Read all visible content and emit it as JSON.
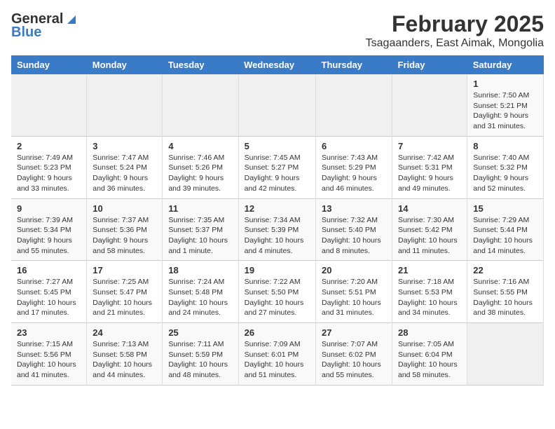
{
  "header": {
    "logo_general": "General",
    "logo_blue": "Blue",
    "title": "February 2025",
    "subtitle": "Tsagaanders, East Aimak, Mongolia"
  },
  "calendar": {
    "days_of_week": [
      "Sunday",
      "Monday",
      "Tuesday",
      "Wednesday",
      "Thursday",
      "Friday",
      "Saturday"
    ],
    "weeks": [
      [
        {
          "day": "",
          "detail": ""
        },
        {
          "day": "",
          "detail": ""
        },
        {
          "day": "",
          "detail": ""
        },
        {
          "day": "",
          "detail": ""
        },
        {
          "day": "",
          "detail": ""
        },
        {
          "day": "",
          "detail": ""
        },
        {
          "day": "1",
          "detail": "Sunrise: 7:50 AM\nSunset: 5:21 PM\nDaylight: 9 hours and 31 minutes."
        }
      ],
      [
        {
          "day": "2",
          "detail": "Sunrise: 7:49 AM\nSunset: 5:23 PM\nDaylight: 9 hours and 33 minutes."
        },
        {
          "day": "3",
          "detail": "Sunrise: 7:47 AM\nSunset: 5:24 PM\nDaylight: 9 hours and 36 minutes."
        },
        {
          "day": "4",
          "detail": "Sunrise: 7:46 AM\nSunset: 5:26 PM\nDaylight: 9 hours and 39 minutes."
        },
        {
          "day": "5",
          "detail": "Sunrise: 7:45 AM\nSunset: 5:27 PM\nDaylight: 9 hours and 42 minutes."
        },
        {
          "day": "6",
          "detail": "Sunrise: 7:43 AM\nSunset: 5:29 PM\nDaylight: 9 hours and 46 minutes."
        },
        {
          "day": "7",
          "detail": "Sunrise: 7:42 AM\nSunset: 5:31 PM\nDaylight: 9 hours and 49 minutes."
        },
        {
          "day": "8",
          "detail": "Sunrise: 7:40 AM\nSunset: 5:32 PM\nDaylight: 9 hours and 52 minutes."
        }
      ],
      [
        {
          "day": "9",
          "detail": "Sunrise: 7:39 AM\nSunset: 5:34 PM\nDaylight: 9 hours and 55 minutes."
        },
        {
          "day": "10",
          "detail": "Sunrise: 7:37 AM\nSunset: 5:36 PM\nDaylight: 9 hours and 58 minutes."
        },
        {
          "day": "11",
          "detail": "Sunrise: 7:35 AM\nSunset: 5:37 PM\nDaylight: 10 hours and 1 minute."
        },
        {
          "day": "12",
          "detail": "Sunrise: 7:34 AM\nSunset: 5:39 PM\nDaylight: 10 hours and 4 minutes."
        },
        {
          "day": "13",
          "detail": "Sunrise: 7:32 AM\nSunset: 5:40 PM\nDaylight: 10 hours and 8 minutes."
        },
        {
          "day": "14",
          "detail": "Sunrise: 7:30 AM\nSunset: 5:42 PM\nDaylight: 10 hours and 11 minutes."
        },
        {
          "day": "15",
          "detail": "Sunrise: 7:29 AM\nSunset: 5:44 PM\nDaylight: 10 hours and 14 minutes."
        }
      ],
      [
        {
          "day": "16",
          "detail": "Sunrise: 7:27 AM\nSunset: 5:45 PM\nDaylight: 10 hours and 17 minutes."
        },
        {
          "day": "17",
          "detail": "Sunrise: 7:25 AM\nSunset: 5:47 PM\nDaylight: 10 hours and 21 minutes."
        },
        {
          "day": "18",
          "detail": "Sunrise: 7:24 AM\nSunset: 5:48 PM\nDaylight: 10 hours and 24 minutes."
        },
        {
          "day": "19",
          "detail": "Sunrise: 7:22 AM\nSunset: 5:50 PM\nDaylight: 10 hours and 27 minutes."
        },
        {
          "day": "20",
          "detail": "Sunrise: 7:20 AM\nSunset: 5:51 PM\nDaylight: 10 hours and 31 minutes."
        },
        {
          "day": "21",
          "detail": "Sunrise: 7:18 AM\nSunset: 5:53 PM\nDaylight: 10 hours and 34 minutes."
        },
        {
          "day": "22",
          "detail": "Sunrise: 7:16 AM\nSunset: 5:55 PM\nDaylight: 10 hours and 38 minutes."
        }
      ],
      [
        {
          "day": "23",
          "detail": "Sunrise: 7:15 AM\nSunset: 5:56 PM\nDaylight: 10 hours and 41 minutes."
        },
        {
          "day": "24",
          "detail": "Sunrise: 7:13 AM\nSunset: 5:58 PM\nDaylight: 10 hours and 44 minutes."
        },
        {
          "day": "25",
          "detail": "Sunrise: 7:11 AM\nSunset: 5:59 PM\nDaylight: 10 hours and 48 minutes."
        },
        {
          "day": "26",
          "detail": "Sunrise: 7:09 AM\nSunset: 6:01 PM\nDaylight: 10 hours and 51 minutes."
        },
        {
          "day": "27",
          "detail": "Sunrise: 7:07 AM\nSunset: 6:02 PM\nDaylight: 10 hours and 55 minutes."
        },
        {
          "day": "28",
          "detail": "Sunrise: 7:05 AM\nSunset: 6:04 PM\nDaylight: 10 hours and 58 minutes."
        },
        {
          "day": "",
          "detail": ""
        }
      ]
    ]
  }
}
